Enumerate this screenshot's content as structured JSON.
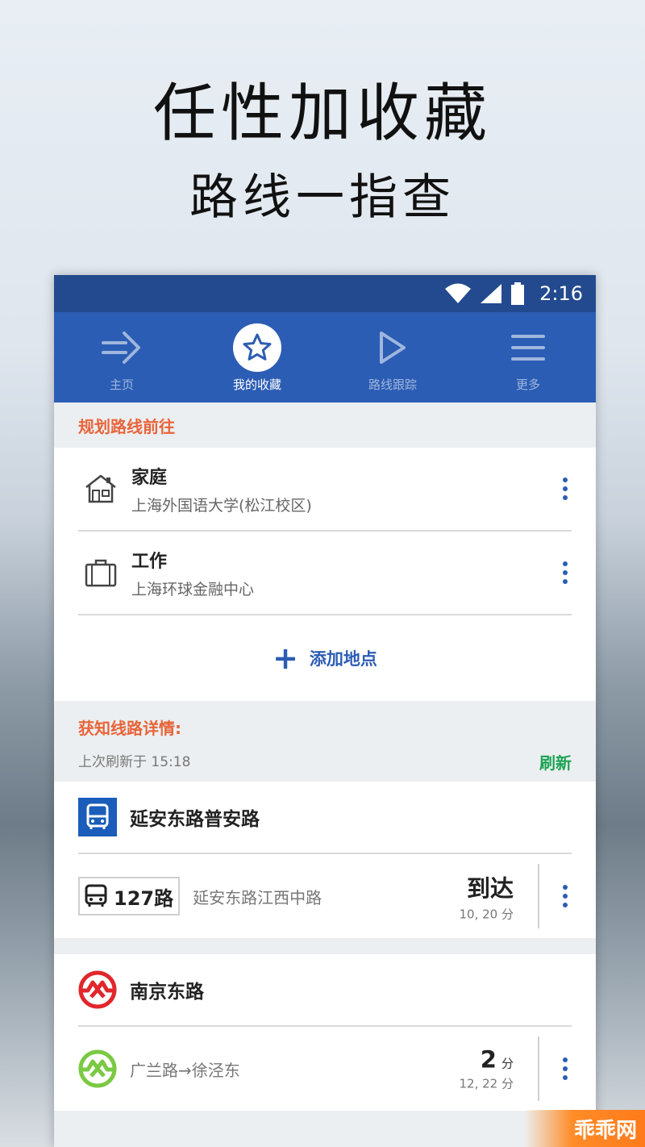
{
  "headline": {
    "line1": "任性加收藏",
    "line2": "路线一指查"
  },
  "status": {
    "time": "2:16"
  },
  "nav": {
    "items": [
      {
        "label": "主页",
        "icon": "arrow-right-icon",
        "active": false
      },
      {
        "label": "我的收藏",
        "icon": "star-icon",
        "active": true
      },
      {
        "label": "路线跟踪",
        "icon": "play-icon",
        "active": false
      },
      {
        "label": "更多",
        "icon": "menu-icon",
        "active": false
      }
    ]
  },
  "plan": {
    "title": "规划路线前往",
    "places": [
      {
        "name": "家庭",
        "address": "上海外国语大学(松江校区)",
        "icon": "house-icon"
      },
      {
        "name": "工作",
        "address": "上海环球金融中心",
        "icon": "briefcase-icon"
      }
    ],
    "add_label": "添加地点"
  },
  "lines": {
    "title": "获知线路详情:",
    "updated": "上次刷新于 15:18",
    "refresh_label": "刷新",
    "stops": [
      {
        "name": "延安东路普安路",
        "icon": "bus-icon",
        "route": "127路",
        "destination": "延安东路江西中路",
        "status": "到达",
        "next": "10, 20 分"
      },
      {
        "name": "南京东路",
        "icon": "metro-icon",
        "destination": "广兰路→徐泾东",
        "minutes": "2",
        "unit": "分",
        "next": "12, 22 分"
      }
    ]
  },
  "watermark": "乖乖网",
  "colors": {
    "accent": "#2c5db4",
    "statusbar": "#234a8e",
    "orange": "#e8643a",
    "green": "#1da355",
    "metro_red": "#e1262c",
    "metro_green": "#7ac943"
  }
}
